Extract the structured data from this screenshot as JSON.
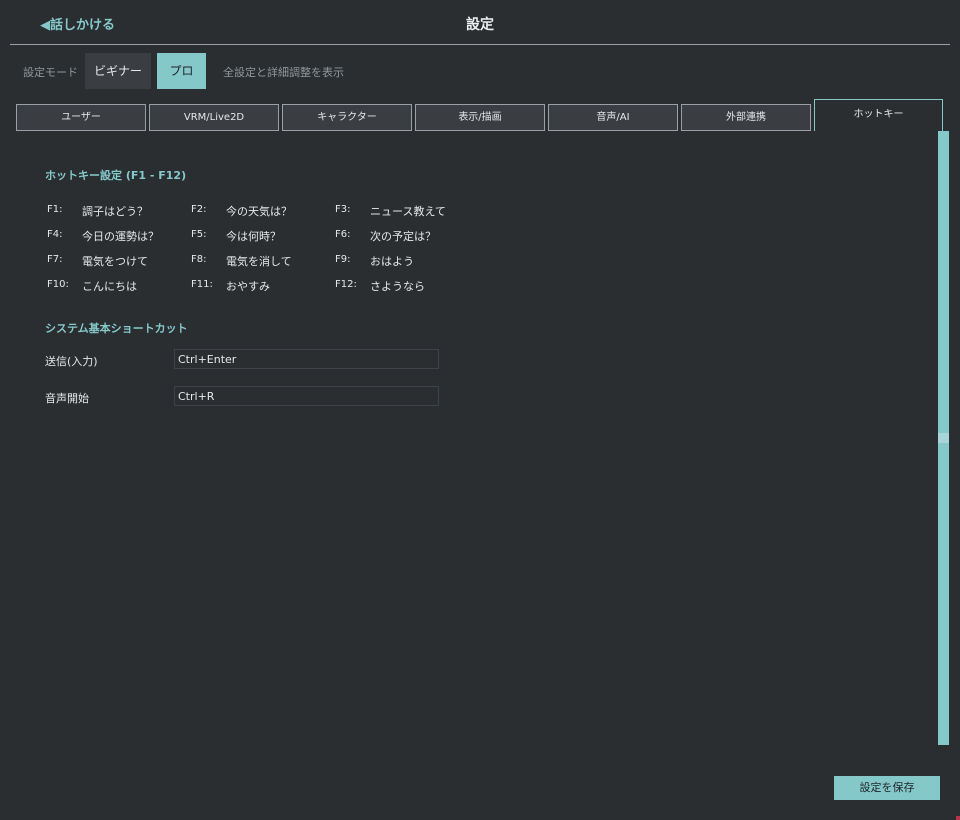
{
  "header": {
    "back_label": "◀話しかける",
    "title": "設定"
  },
  "mode": {
    "label": "設定モード",
    "beginner_label": "ビギナー",
    "pro_label": "プロ",
    "description": "全設定と詳細調整を表示"
  },
  "tabs": [
    {
      "label": "ユーザー"
    },
    {
      "label": "VRM/Live2D"
    },
    {
      "label": "キャラクター"
    },
    {
      "label": "表示/描画"
    },
    {
      "label": "音声/AI"
    },
    {
      "label": "外部連携"
    },
    {
      "label": "ホットキー",
      "active": true
    }
  ],
  "hotkeys": {
    "title": "ホットキー設定 (F1 - F12)",
    "items": [
      {
        "key": "F1:",
        "value": "調子はどう？"
      },
      {
        "key": "F2:",
        "value": "今の天気は？"
      },
      {
        "key": "F3:",
        "value": "ニュース教えて"
      },
      {
        "key": "F4:",
        "value": "今日の運勢は？"
      },
      {
        "key": "F5:",
        "value": "今は何時？"
      },
      {
        "key": "F6:",
        "value": "次の予定は？"
      },
      {
        "key": "F7:",
        "value": "電気をつけて"
      },
      {
        "key": "F8:",
        "value": "電気を消して"
      },
      {
        "key": "F9:",
        "value": "おはよう"
      },
      {
        "key": "F10:",
        "value": "こんにちは"
      },
      {
        "key": "F11:",
        "value": "おやすみ"
      },
      {
        "key": "F12:",
        "value": "さようなら"
      }
    ]
  },
  "shortcuts": {
    "title": "システム基本ショートカット",
    "items": [
      {
        "label": "送信(入力)",
        "value": "Ctrl+Enter"
      },
      {
        "label": "音声開始",
        "value": "Ctrl+R"
      }
    ]
  },
  "footer": {
    "save_label": "設定を保存"
  },
  "colors": {
    "accent": "#84c8ca",
    "background": "#2b2e31",
    "tab_bg": "#3a3e42"
  }
}
